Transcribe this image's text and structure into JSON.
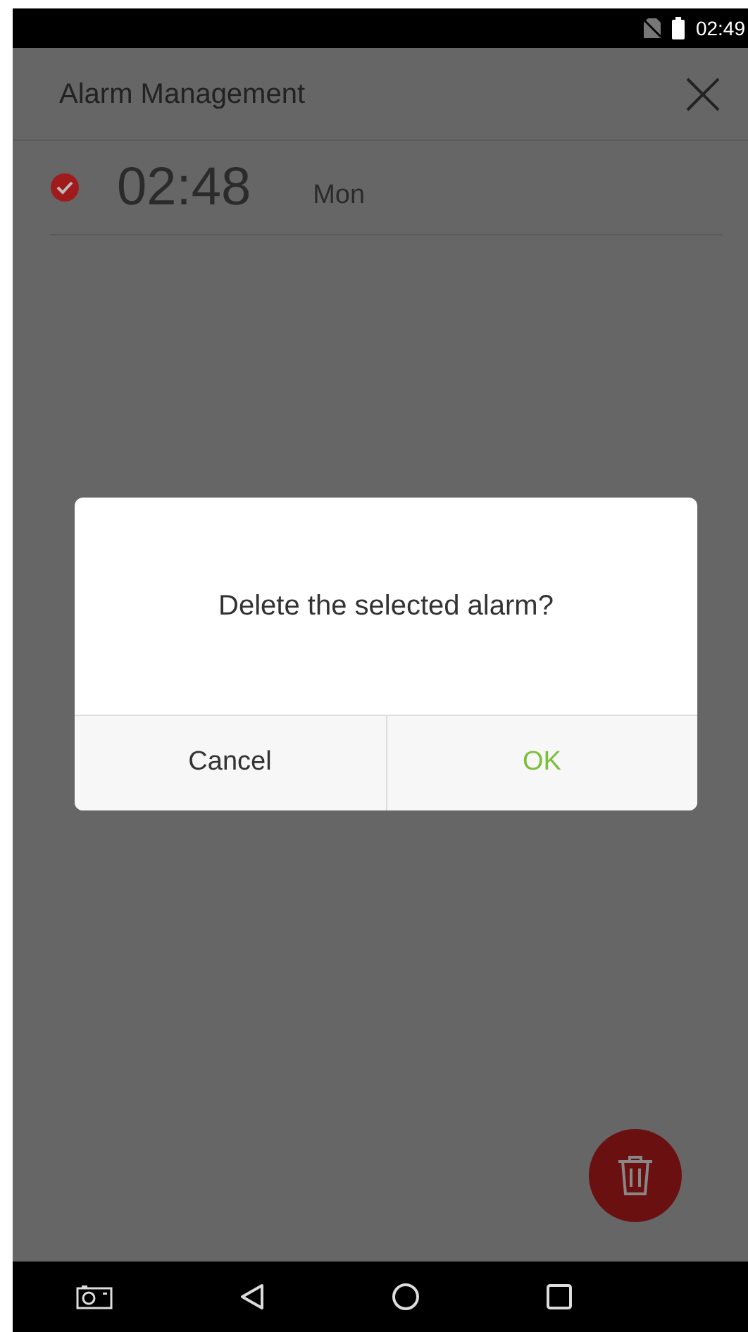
{
  "status_bar": {
    "time": "02:49"
  },
  "header": {
    "title": "Alarm Management"
  },
  "alarms": [
    {
      "time": "02:48",
      "days": "Mon",
      "selected": true
    }
  ],
  "dialog": {
    "message": "Delete the selected alarm?",
    "buttons": [
      {
        "label": "Cancel",
        "kind": "cancel"
      },
      {
        "label": "OK",
        "kind": "confirm"
      }
    ]
  }
}
